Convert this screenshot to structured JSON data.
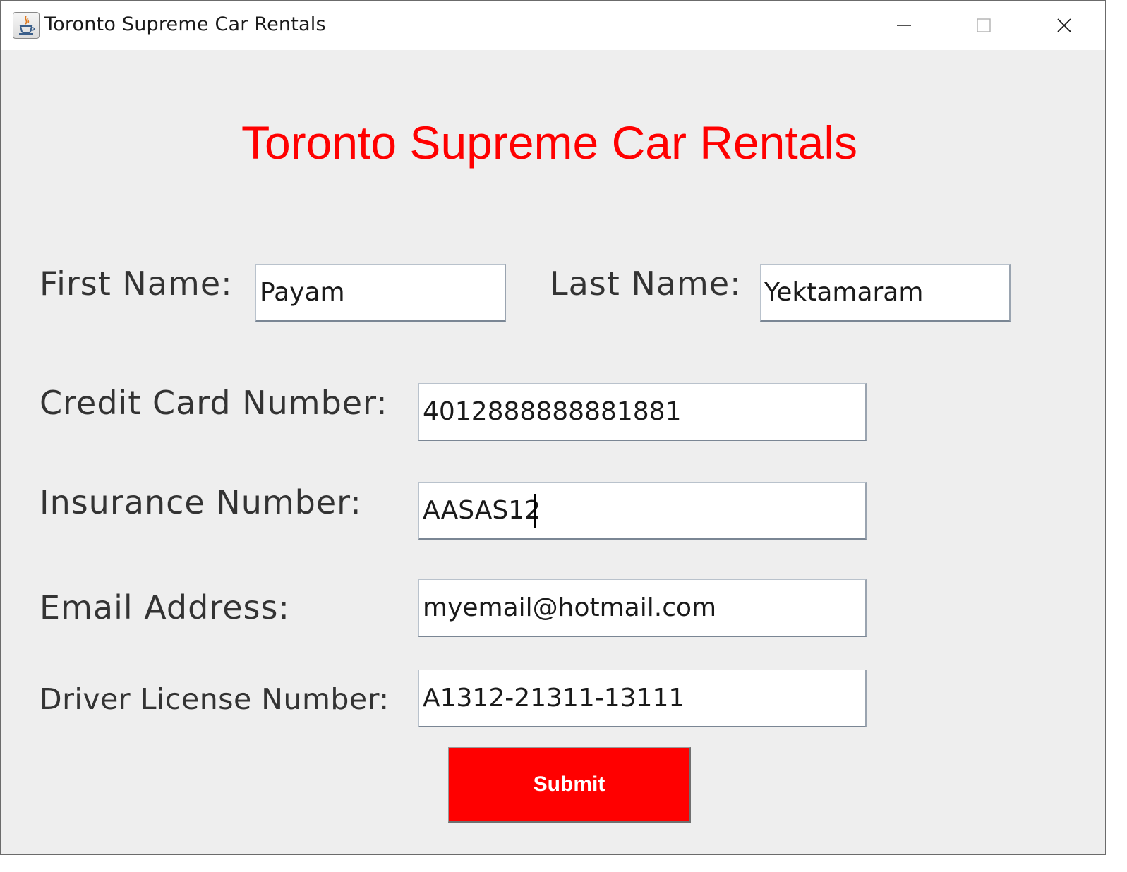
{
  "window": {
    "title": "Toronto Supreme Car Rentals",
    "icon": "java-cup-icon"
  },
  "form": {
    "heading": "Toronto Supreme Car Rentals",
    "first_name": {
      "label": "First Name:",
      "value": "Payam"
    },
    "last_name": {
      "label": "Last Name:",
      "value": "Yektamaram"
    },
    "credit_card": {
      "label": "Credit Card Number:",
      "value": "4012888888881881"
    },
    "insurance": {
      "label": "Insurance Number:",
      "value": "AASAS12"
    },
    "email": {
      "label": "Email Address:",
      "value": "myemail@hotmail.com"
    },
    "driver_license": {
      "label": "Driver License Number:",
      "value": "A1312-21311-13111"
    },
    "submit_label": "Submit"
  },
  "colors": {
    "heading": "#ff0000",
    "submit_bg": "#ff0000",
    "submit_text": "#ffffff",
    "panel_bg": "#eeeeee"
  }
}
